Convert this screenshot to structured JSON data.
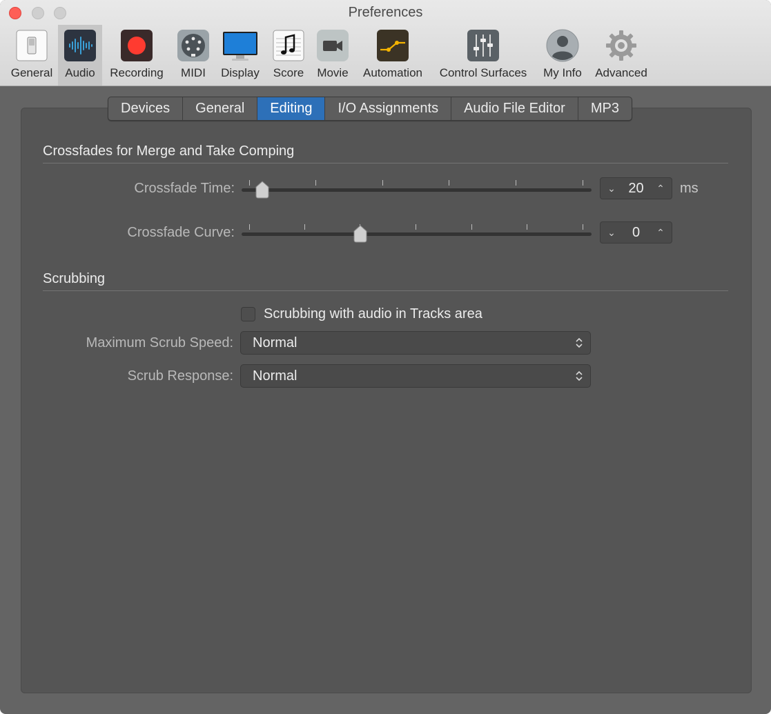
{
  "window": {
    "title": "Preferences"
  },
  "toolbar": {
    "items": [
      {
        "label": "General",
        "icon": "general-switch-icon"
      },
      {
        "label": "Audio",
        "icon": "audio-waveform-icon",
        "selected": true
      },
      {
        "label": "Recording",
        "icon": "record-icon"
      },
      {
        "label": "MIDI",
        "icon": "midi-connector-icon"
      },
      {
        "label": "Display",
        "icon": "display-monitor-icon"
      },
      {
        "label": "Score",
        "icon": "music-note-icon"
      },
      {
        "label": "Movie",
        "icon": "movie-camera-icon"
      },
      {
        "label": "Automation",
        "icon": "automation-curve-icon"
      },
      {
        "label": "Control Surfaces",
        "icon": "faders-icon"
      },
      {
        "label": "My Info",
        "icon": "user-silhouette-icon"
      },
      {
        "label": "Advanced",
        "icon": "gear-icon"
      }
    ]
  },
  "tabs": {
    "items": [
      "Devices",
      "General",
      "Editing",
      "I/O Assignments",
      "Audio File Editor",
      "MP3"
    ],
    "selected": "Editing"
  },
  "crossfades": {
    "title": "Crossfades for Merge and Take Comping",
    "time": {
      "label": "Crossfade Time:",
      "value": "20",
      "unit": "ms",
      "slider_fraction": 0.06
    },
    "curve": {
      "label": "Crossfade Curve:",
      "value": "0",
      "slider_fraction": 0.34
    }
  },
  "scrubbing": {
    "title": "Scrubbing",
    "checkbox_label": "Scrubbing with audio in Tracks area",
    "checkbox_checked": false,
    "max_speed": {
      "label": "Maximum Scrub Speed:",
      "value": "Normal"
    },
    "response": {
      "label": "Scrub Response:",
      "value": "Normal"
    }
  },
  "colors": {
    "selected_tab": "#2d70b8",
    "close_button": "#fe5f57",
    "record_red": "#ff3b30",
    "audio_accent": "#3aa0d8",
    "automation_yellow": "#f5b400"
  }
}
